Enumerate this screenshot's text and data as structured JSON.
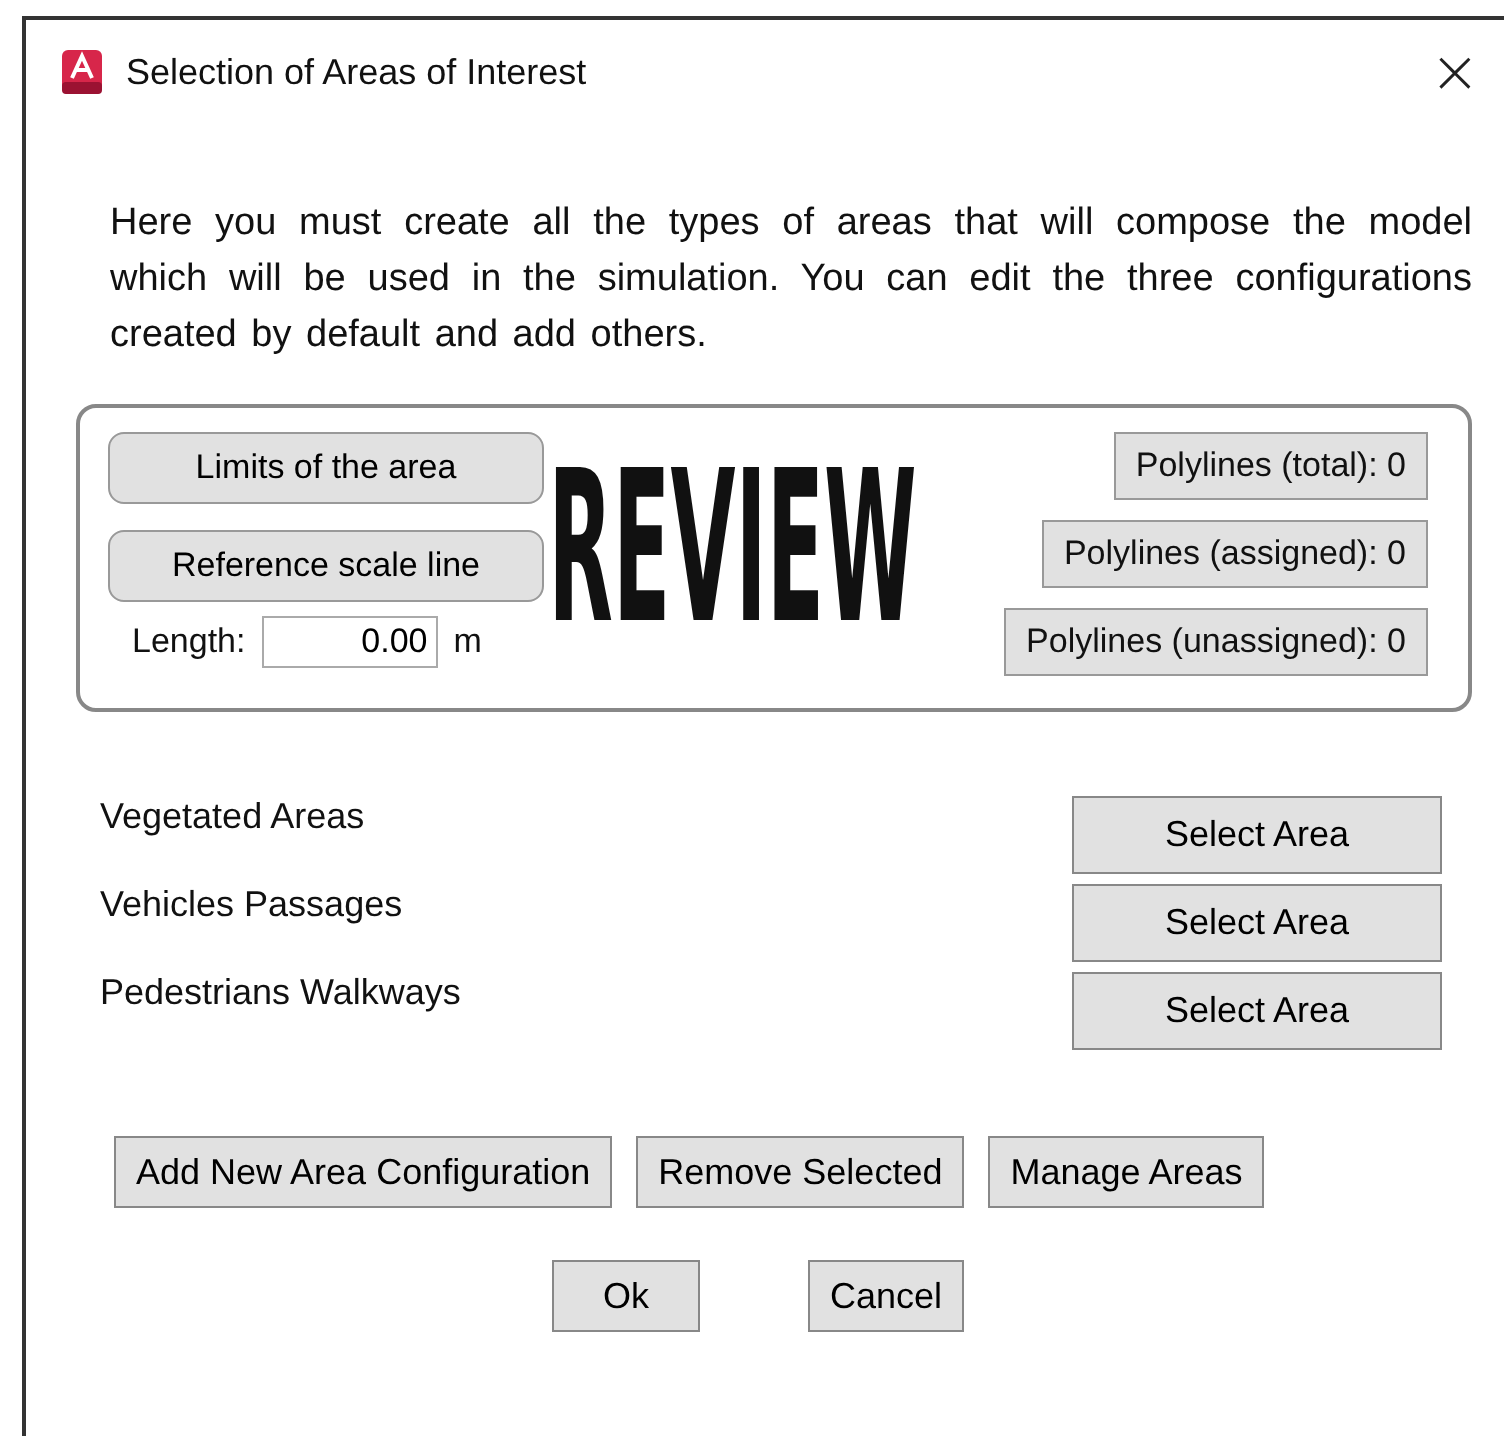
{
  "window": {
    "title": "Selection of Areas of Interest",
    "close": "×"
  },
  "intro": "Here you must create all the types of areas that will compose the model which will be used in the simulation. You can edit the three configurations created by default and add others.",
  "scale_panel": {
    "buttons": [
      "Limits of the area",
      "Reference scale line"
    ],
    "length_label": "Length:",
    "length_value": "0.00",
    "length_unit": "m",
    "stamp": "REVIEW",
    "counters": [
      "Polylines (total): 0",
      "Polylines (assigned): 0",
      "Polylines (unassigned): 0"
    ]
  },
  "areas": [
    {
      "name": "Vegetated Areas",
      "button": "Select Area"
    },
    {
      "name": "Vehicles Passages",
      "button": "Select Area"
    },
    {
      "name": "Pedestrians Walkways",
      "button": "Select Area"
    }
  ],
  "actions": [
    "Add New Area Configuration",
    "Remove Selected",
    "Manage Areas"
  ],
  "dialog_buttons": [
    "Ok",
    "Cancel"
  ]
}
